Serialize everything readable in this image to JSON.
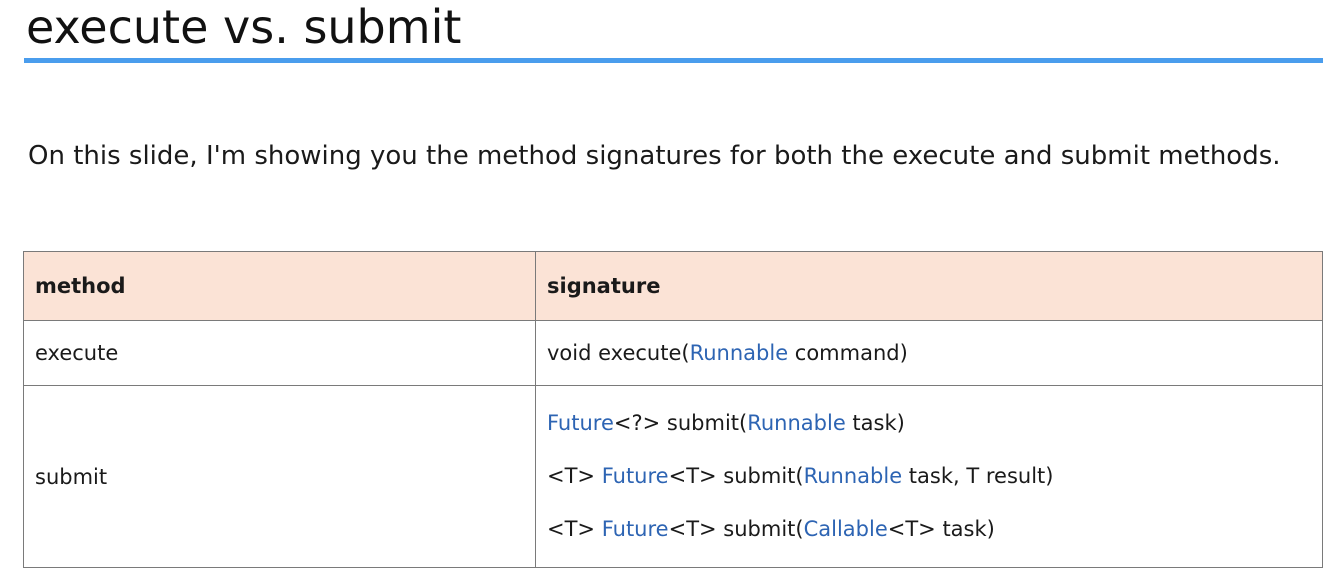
{
  "slide": {
    "title": "execute vs. submit",
    "intro": "On this slide, I'm showing you the method signatures for both the execute and submit methods."
  },
  "colors": {
    "title_rule": "#4a9ded",
    "header_background": "#fbe3d6",
    "type_highlight": "#2d64b3"
  },
  "table": {
    "headers": [
      "method",
      "signature"
    ],
    "rows": [
      {
        "method": "execute",
        "signatures": [
          [
            {
              "text": "void execute(",
              "type": false
            },
            {
              "text": "Runnable",
              "type": true
            },
            {
              "text": " command)",
              "type": false
            }
          ]
        ]
      },
      {
        "method": "submit",
        "signatures": [
          [
            {
              "text": "Future",
              "type": true
            },
            {
              "text": "<?> submit(",
              "type": false
            },
            {
              "text": "Runnable",
              "type": true
            },
            {
              "text": " task)",
              "type": false
            }
          ],
          [
            {
              "text": "<T> ",
              "type": false
            },
            {
              "text": "Future",
              "type": true
            },
            {
              "text": "<T> submit(",
              "type": false
            },
            {
              "text": "Runnable",
              "type": true
            },
            {
              "text": " task, T result)",
              "type": false
            }
          ],
          [
            {
              "text": "<T> ",
              "type": false
            },
            {
              "text": "Future",
              "type": true
            },
            {
              "text": "<T> submit(",
              "type": false
            },
            {
              "text": "Callable",
              "type": true
            },
            {
              "text": "<T> task)",
              "type": false
            }
          ]
        ]
      }
    ]
  }
}
